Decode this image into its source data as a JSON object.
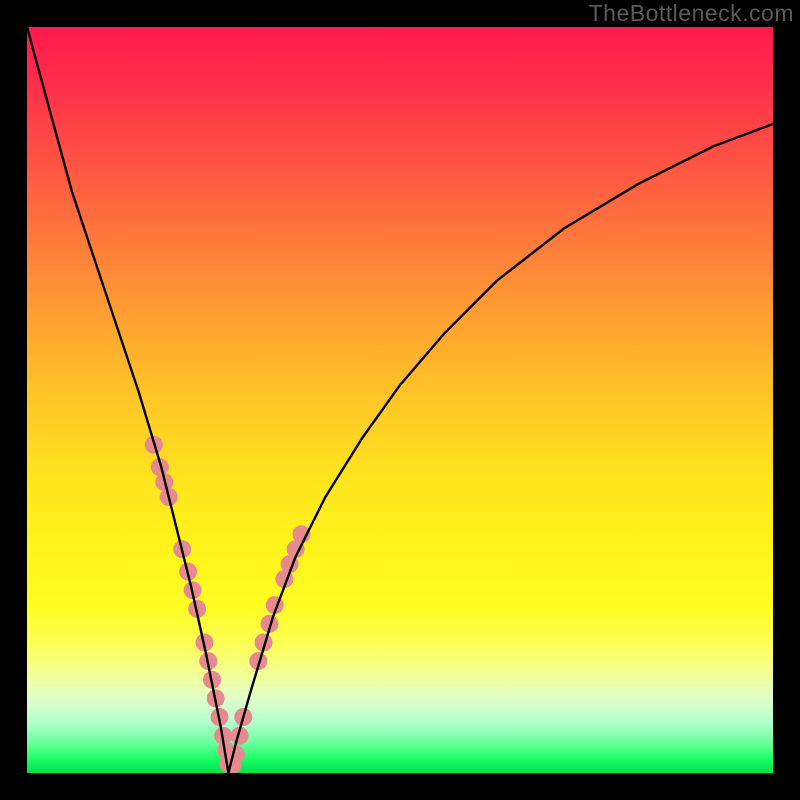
{
  "watermark": "TheBottleneck.com",
  "chart_data": {
    "type": "line",
    "title": "",
    "xlabel": "",
    "ylabel": "",
    "xlim": [
      0,
      100
    ],
    "ylim": [
      0,
      100
    ],
    "gradient_stops": [
      {
        "pct": 0,
        "color": "#ff1a4d"
      },
      {
        "pct": 20,
        "color": "#ff5a42"
      },
      {
        "pct": 48,
        "color": "#ffc028"
      },
      {
        "pct": 70,
        "color": "#fff41a"
      },
      {
        "pct": 90,
        "color": "#e0ffc8"
      },
      {
        "pct": 100,
        "color": "#00e24d"
      }
    ],
    "series": [
      {
        "name": "bottleneck-curve",
        "x": [
          0,
          3,
          6,
          9,
          12,
          15,
          18,
          20,
          22,
          24,
          26,
          27,
          28,
          30,
          33,
          36,
          40,
          45,
          50,
          56,
          63,
          72,
          82,
          92,
          100
        ],
        "y": [
          100,
          89,
          78,
          69,
          60,
          51,
          41,
          33,
          25,
          16,
          6,
          0,
          4,
          11,
          21,
          29,
          37,
          45,
          52,
          59,
          66,
          73,
          79,
          84,
          87
        ]
      }
    ],
    "markers": {
      "name": "highlight-dots",
      "color": "#e68a8f",
      "radius_px": 9,
      "points": [
        {
          "x": 17.0,
          "y": 44.0
        },
        {
          "x": 17.8,
          "y": 41.0
        },
        {
          "x": 18.4,
          "y": 39.0
        },
        {
          "x": 19.0,
          "y": 37.0
        },
        {
          "x": 20.8,
          "y": 30.0
        },
        {
          "x": 21.6,
          "y": 27.0
        },
        {
          "x": 22.2,
          "y": 24.5
        },
        {
          "x": 22.8,
          "y": 22.0
        },
        {
          "x": 23.8,
          "y": 17.5
        },
        {
          "x": 24.3,
          "y": 15.0
        },
        {
          "x": 24.8,
          "y": 12.5
        },
        {
          "x": 25.3,
          "y": 10.0
        },
        {
          "x": 25.8,
          "y": 7.5
        },
        {
          "x": 26.3,
          "y": 5.0
        },
        {
          "x": 26.7,
          "y": 3.0
        },
        {
          "x": 27.0,
          "y": 1.2
        },
        {
          "x": 27.5,
          "y": 1.0
        },
        {
          "x": 28.0,
          "y": 2.5
        },
        {
          "x": 28.5,
          "y": 5.0
        },
        {
          "x": 29.0,
          "y": 7.5
        },
        {
          "x": 31.0,
          "y": 15.0
        },
        {
          "x": 31.7,
          "y": 17.5
        },
        {
          "x": 32.5,
          "y": 20.0
        },
        {
          "x": 33.2,
          "y": 22.5
        },
        {
          "x": 34.5,
          "y": 26.0
        },
        {
          "x": 35.2,
          "y": 28.0
        },
        {
          "x": 36.0,
          "y": 30.0
        },
        {
          "x": 36.8,
          "y": 32.0
        }
      ]
    }
  }
}
